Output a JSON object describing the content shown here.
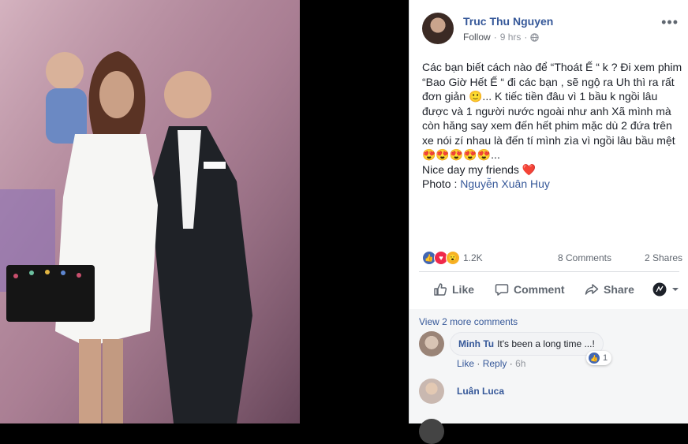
{
  "post": {
    "author": "Truc Thu Nguyen",
    "follow_label": "Follow",
    "time": "9 hrs",
    "menu_icon": "more-dots-icon",
    "text_lines": [
      "Các bạn biết cách nào để “Thoát Ế “ k ? Đi xem phim “Bao Giờ Hết Ế “ đi các bạn , sẽ ngộ ra Uh thì ra rất đơn giản 🙂... K tiếc tiền đâu vì 1 bầu k ngồi lâu được và 1 người nước ngoài như anh Xã mình mà còn hăng say xem đến hết phim mặc dù 2 đứa trên xe nói zí nhau là đến tí mình zìa vì ngồi lâu bầu mệt 😍😍😍😍😍...",
      "Nice day my friends ❤️"
    ],
    "photo_prefix": "Photo : ",
    "photo_credit": "Nguyễn Xuân Huy"
  },
  "stats": {
    "reactions": "1.2K",
    "comments": "8 Comments",
    "shares": "2 Shares"
  },
  "actions": {
    "like": "Like",
    "comment": "Comment",
    "share": "Share"
  },
  "comments": {
    "view_more": "View 2 more comments",
    "items": [
      {
        "author": "Minh Tu",
        "text": "It's been a long time ...!",
        "like": "Like",
        "reply": "Reply",
        "time": "6h",
        "reaction_count": "1"
      },
      {
        "author": "Luân Luca"
      }
    ]
  },
  "colors": {
    "link": "#365899",
    "like_blue": "#4267b2",
    "love_red": "#f0284a",
    "wow_yellow": "#f7b125"
  }
}
